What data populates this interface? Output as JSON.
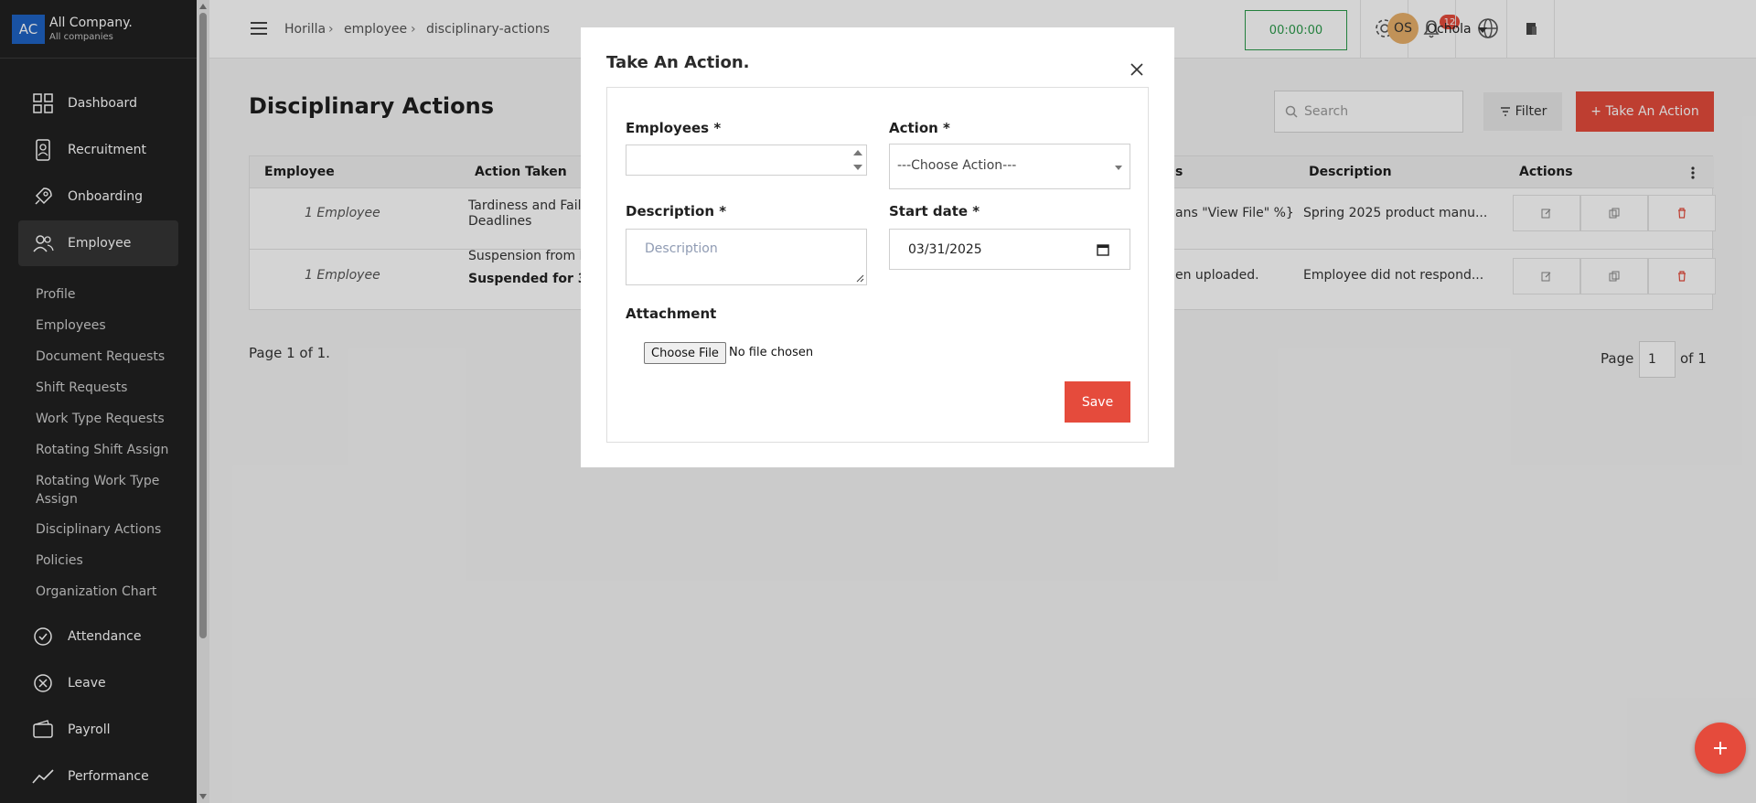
{
  "company": {
    "logo": "AC",
    "name": "All Company.",
    "sub": "All companies"
  },
  "sidebar": {
    "items": [
      {
        "label": "Dashboard",
        "icon": "dashboard-icon"
      },
      {
        "label": "Recruitment",
        "icon": "recruitment-icon"
      },
      {
        "label": "Onboarding",
        "icon": "rocket-icon"
      },
      {
        "label": "Employee",
        "icon": "users-icon"
      },
      {
        "label": "Attendance",
        "icon": "check-circle-icon"
      },
      {
        "label": "Leave",
        "icon": "x-circle-icon"
      },
      {
        "label": "Payroll",
        "icon": "wallet-icon"
      },
      {
        "label": "Performance",
        "icon": "trend-icon"
      }
    ],
    "subitems": [
      "Profile",
      "Employees",
      "Document Requests",
      "Shift Requests",
      "Work Type Requests",
      "Rotating Shift Assign",
      "Rotating Work Type Assign",
      "Disciplinary Actions",
      "Policies",
      "Organization Chart"
    ]
  },
  "topbar": {
    "breadcrumb": [
      "Horilla",
      "employee",
      "disciplinary-actions"
    ],
    "timer": "00:00:00",
    "notifications": "12",
    "user_initials": "OS",
    "user_name": "Ochola"
  },
  "page": {
    "title": "Disciplinary Actions",
    "search_placeholder": "Search",
    "filter_label": "Filter",
    "action_label": "+ Take An Action",
    "page_info": "Page 1 of 1.",
    "pager_label": "Page",
    "pager_value": "1",
    "pager_of": "of 1"
  },
  "table": {
    "headers": [
      "Employee",
      "Action Taken",
      "s",
      "Description",
      "Actions"
    ],
    "rows": [
      {
        "employee": "1 Employee",
        "action_line1": "Tardiness and Failu",
        "action_line2": "Deadlines",
        "attachment": "ans \"View File\" %}",
        "description": "Spring 2025 product manu..."
      },
      {
        "employee": "1 Employee",
        "action_line1": "Suspension from IT",
        "action_line2": "Suspended for 3 da",
        "attachment": "en uploaded.",
        "description": "Employee did not respond..."
      }
    ]
  },
  "modal": {
    "title": "Take An Action.",
    "employees_label": "Employees *",
    "action_label": "Action *",
    "action_placeholder": "---Choose Action---",
    "description_label": "Description *",
    "description_placeholder": "Description",
    "start_label": "Start date *",
    "start_value": "03/31/2025",
    "attachment_label": "Attachment",
    "file_button": "Choose File",
    "file_text": "No file chosen",
    "save_label": "Save"
  },
  "colors": {
    "accent": "#e54b3c",
    "sidebar": "#212121",
    "timer": "#2b9a4a",
    "company_logo": "#1f63c5"
  }
}
